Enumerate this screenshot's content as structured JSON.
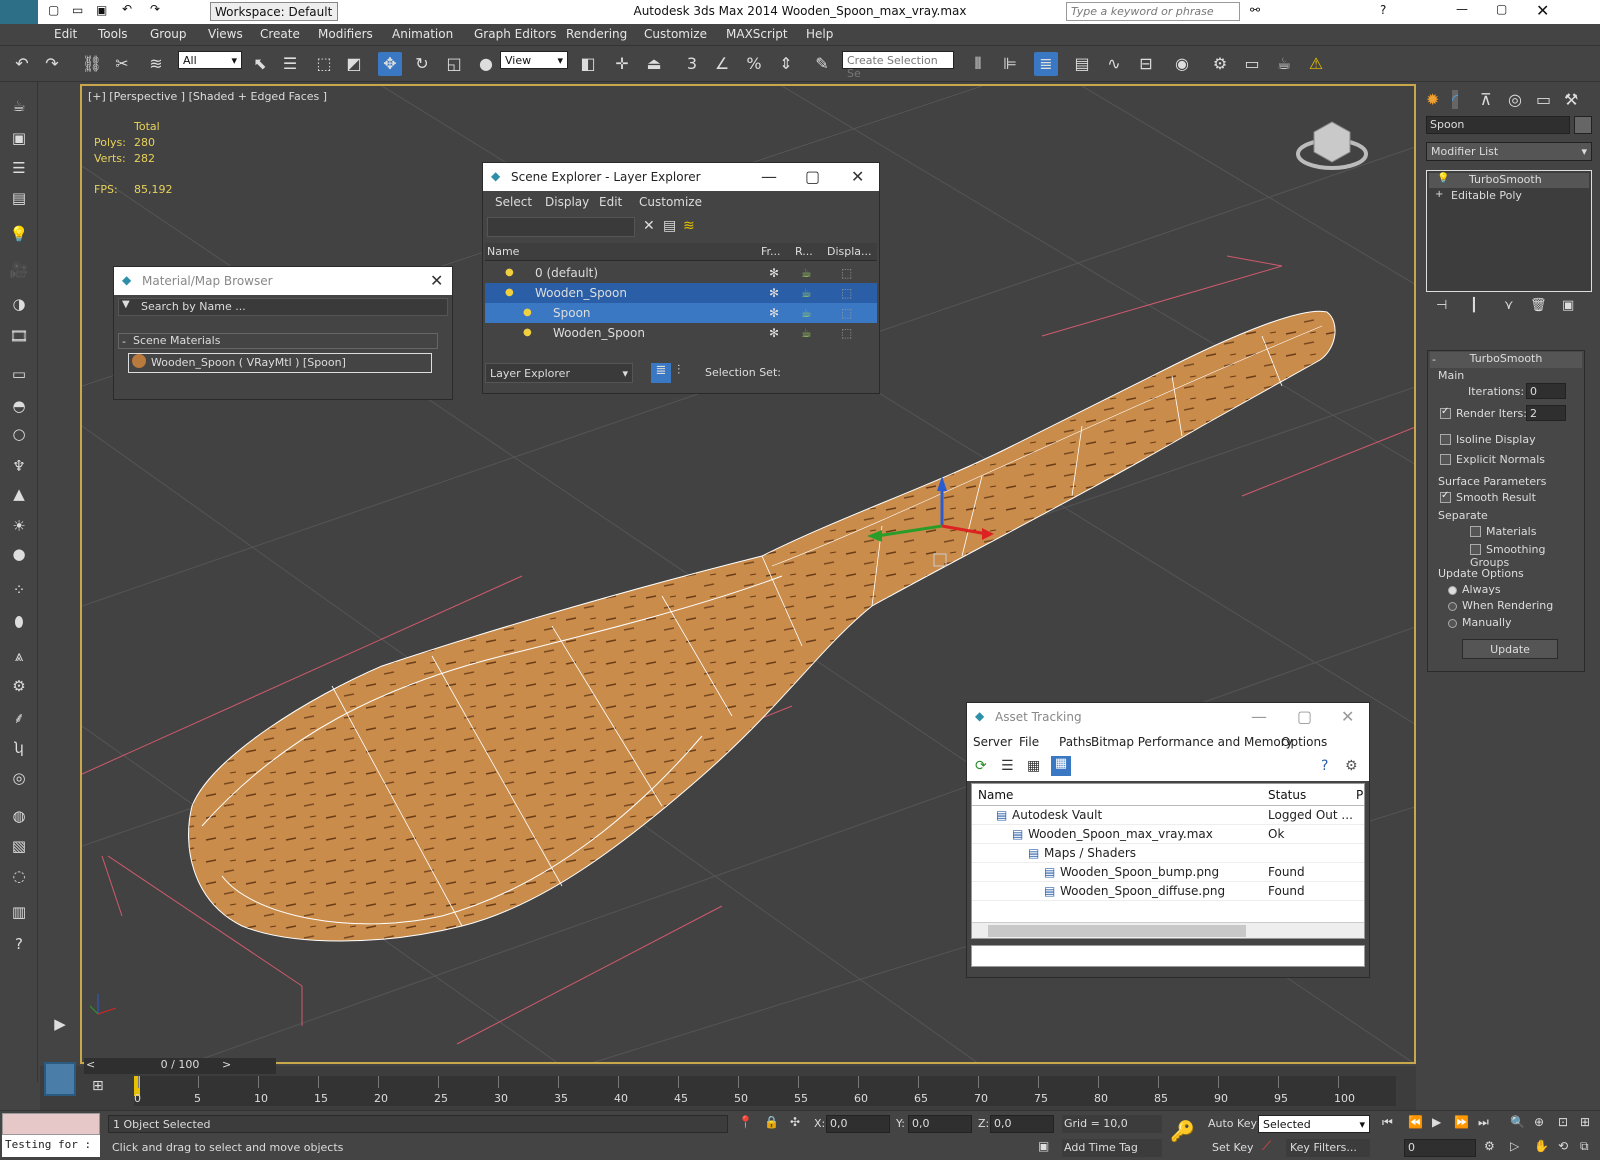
{
  "window": {
    "title_left": "Workspace: Default",
    "title": "Autodesk 3ds Max  2014     Wooden_Spoon_max_vray.max",
    "search_placeholder": "Type a keyword or phrase"
  },
  "menu": [
    "Edit",
    "Tools",
    "Group",
    "Views",
    "Create",
    "Modifiers",
    "Animation",
    "Graph Editors",
    "Rendering",
    "Customize",
    "MAXScript",
    "Help"
  ],
  "toolbar": {
    "filter": "All",
    "ref_coord": "View",
    "selection_set": "Create Selection Se"
  },
  "viewport": {
    "label": "[+] [Perspective ] [Shaded + Edged Faces ]",
    "stats_header": "Total",
    "polys_label": "Polys:",
    "polys": "280",
    "verts_label": "Verts:",
    "verts": "282",
    "fps_label": "FPS:",
    "fps": "85,192"
  },
  "material_browser": {
    "title": "Material/Map Browser",
    "search": "Search by Name ...",
    "group": "Scene Materials",
    "item": "Wooden_Spoon  ( VRayMtl ) [Spoon]"
  },
  "scene_explorer": {
    "title": "Scene Explorer - Layer Explorer",
    "menu": [
      "Select",
      "Display",
      "Edit",
      "Customize"
    ],
    "columns": [
      "Name",
      "Fr...",
      "R...",
      "Displa..."
    ],
    "rows": [
      {
        "name": "0 (default)",
        "level": 0
      },
      {
        "name": "Wooden_Spoon",
        "level": 0
      },
      {
        "name": "Spoon",
        "level": 1
      },
      {
        "name": "Wooden_Spoon",
        "level": 1
      }
    ],
    "footer_mode": "Layer Explorer",
    "selection_set": "Selection Set:"
  },
  "asset_tracking": {
    "title": "Asset Tracking",
    "menu": [
      "Server",
      "File",
      "Paths",
      "Bitmap Performance and Memory",
      "Options"
    ],
    "columns": [
      "Name",
      "Status",
      "P"
    ],
    "rows": [
      {
        "name": "Autodesk Vault",
        "status": "Logged Out ...",
        "level": 1
      },
      {
        "name": "Wooden_Spoon_max_vray.max",
        "status": "Ok",
        "level": 2
      },
      {
        "name": "Maps / Shaders",
        "status": "",
        "level": 3
      },
      {
        "name": "Wooden_Spoon_bump.png",
        "status": "Found",
        "level": 4
      },
      {
        "name": "Wooden_Spoon_diffuse.png",
        "status": "Found",
        "level": 4
      }
    ]
  },
  "command_panel": {
    "object_name": "Spoon",
    "modifier_list": "Modifier List",
    "stack": [
      "TurboSmooth",
      "Editable Poly"
    ],
    "turbosmooth": {
      "title": "TurboSmooth",
      "main": "Main",
      "iterations_label": "Iterations:",
      "iterations": "0",
      "render_iters_label": "Render Iters:",
      "render_iters": "2",
      "isoline": "Isoline Display",
      "explicit": "Explicit Normals",
      "surface": "Surface Parameters",
      "smooth_result": "Smooth Result",
      "separate": "Separate",
      "materials": "Materials",
      "smoothing_groups": "Smoothing Groups",
      "update_options": "Update Options",
      "always": "Always",
      "when_rendering": "When Rendering",
      "manually": "Manually",
      "update": "Update"
    }
  },
  "timeline": {
    "frame": "0 / 100",
    "ticks": [
      "0",
      "5",
      "10",
      "15",
      "20",
      "25",
      "30",
      "35",
      "40",
      "45",
      "50",
      "55",
      "60",
      "65",
      "70",
      "75",
      "80",
      "85",
      "90",
      "95",
      "100"
    ]
  },
  "status": {
    "script": "Testing for :",
    "selected": "1 Object Selected",
    "prompt": "Click and drag to select and move objects",
    "x_label": "X:",
    "x": "0,0",
    "y_label": "Y:",
    "y": "0,0",
    "z_label": "Z:",
    "z": "0,0",
    "grid": "Grid = 10,0",
    "add_time_tag": "Add Time Tag",
    "auto_key": "Auto Key",
    "set_key": "Set Key",
    "key_mode": "Selected",
    "key_filters": "Key Filters...",
    "frame": "0"
  }
}
